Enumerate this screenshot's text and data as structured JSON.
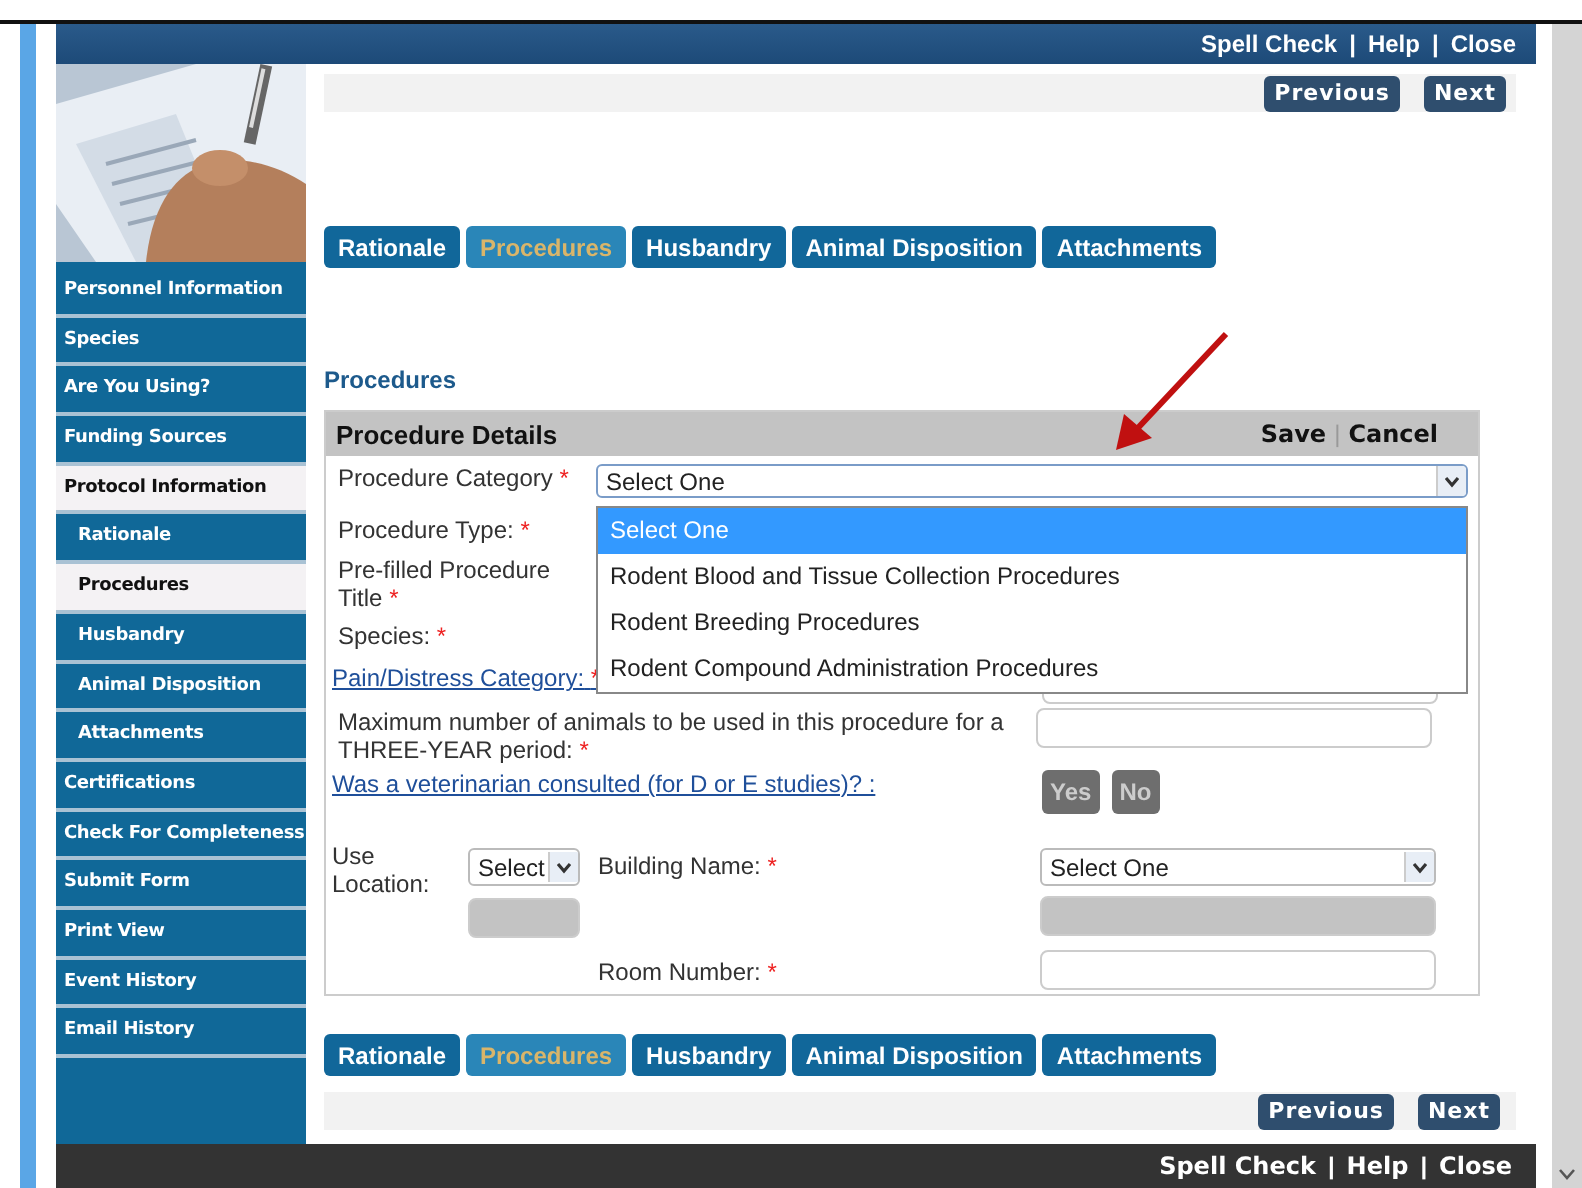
{
  "header_links": [
    "Spell Check",
    "Help",
    "Close"
  ],
  "link_separator": "|",
  "sidebar": {
    "items": [
      {
        "label": "Personnel Information",
        "selected": false
      },
      {
        "label": "Species",
        "selected": false
      },
      {
        "label": "Are You Using?",
        "selected": false
      },
      {
        "label": "Funding Sources",
        "selected": false
      },
      {
        "label": "Protocol Information",
        "selected": true,
        "children": [
          {
            "label": "Rationale",
            "selected": false
          },
          {
            "label": "Procedures",
            "selected": true
          },
          {
            "label": "Husbandry",
            "selected": false
          },
          {
            "label": "Animal Disposition",
            "selected": false
          },
          {
            "label": "Attachments",
            "selected": false
          }
        ]
      },
      {
        "label": "Certifications",
        "selected": false
      },
      {
        "label": "Check For Completeness",
        "selected": false
      },
      {
        "label": "Submit Form",
        "selected": false
      },
      {
        "label": "Print View",
        "selected": false
      },
      {
        "label": "Event History",
        "selected": false
      },
      {
        "label": "Email History",
        "selected": false
      }
    ]
  },
  "nav_buttons": [
    "Previous",
    "Next"
  ],
  "tabs": [
    {
      "label": "Rationale",
      "selected": false
    },
    {
      "label": "Procedures",
      "selected": true
    },
    {
      "label": "Husbandry",
      "selected": false
    },
    {
      "label": "Animal Disposition",
      "selected": false
    },
    {
      "label": "Attachments",
      "selected": false
    }
  ],
  "section_title": "Procedures",
  "panel": {
    "title": "Procedure Details",
    "actions": [
      "Save",
      "Cancel"
    ],
    "action_separator": "|",
    "category": {
      "label": "Procedure Category",
      "value": "Select One",
      "expanded": true,
      "options": [
        {
          "label": "Select One",
          "selected": true
        },
        {
          "label": "Rodent Blood and Tissue Collection Procedures",
          "selected": false
        },
        {
          "label": "Rodent Breeding Procedures",
          "selected": false
        },
        {
          "label": "Rodent Compound Administration Procedures",
          "selected": false
        }
      ]
    },
    "type_label": "Procedure Type:",
    "title_label": "Pre-filled Procedure Title",
    "species_label": "Species:",
    "pain_label": "Pain/Distress Category:",
    "max_label": "Maximum number of animals to be used in this procedure for a THREE-YEAR period:",
    "vet_label": "Was a veterinarian consulted (for D or E studies)? :",
    "vet_buttons": [
      {
        "label": "Yes",
        "disabled": true
      },
      {
        "label": "No",
        "disabled": true
      }
    ],
    "use_location": {
      "label": "Use Location:",
      "value": "Select"
    },
    "building": {
      "label": "Building Name:",
      "value": "Select One"
    },
    "room_label": "Room Number:",
    "required_mark": "*"
  },
  "bottom_tabs": [
    {
      "label": "Rationale",
      "selected": false
    },
    {
      "label": "Procedures",
      "selected": true
    },
    {
      "label": "Husbandry",
      "selected": false
    },
    {
      "label": "Animal Disposition",
      "selected": false
    },
    {
      "label": "Attachments",
      "selected": false
    }
  ],
  "bottom_nav_buttons": [
    "Previous",
    "Next"
  ],
  "footer_links": [
    "Spell Check",
    "Help",
    "Close"
  ]
}
